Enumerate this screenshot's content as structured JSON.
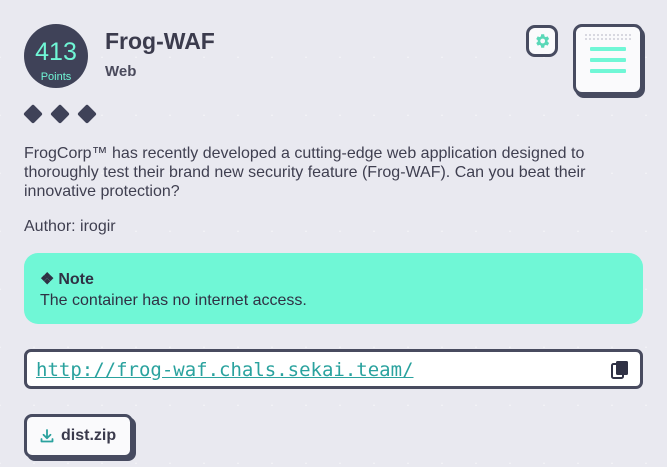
{
  "challenge": {
    "points": "413",
    "points_label": "Points",
    "title": "Frog-WAF",
    "category": "Web",
    "difficulty": 3,
    "description": "FrogCorp™ has recently developed a cutting-edge web application designed to thoroughly test their brand new security feature (Frog-WAF). Can you beat their innovative protection?",
    "author": "Author: irogir"
  },
  "note": {
    "symbol": "❖",
    "title": "Note",
    "text": "The container has no internet access."
  },
  "connection": {
    "url": "http://frog-waf.chals.sekai.team/"
  },
  "attachment": {
    "label": "dist.zip"
  },
  "icons": {
    "settings": "gear-icon",
    "menu": "hamburger-menu-icon",
    "copy": "copy-icon",
    "download": "download-icon"
  },
  "colors": {
    "accent": "#70f7d6",
    "dark": "#3f4258",
    "link": "#2aa29e"
  }
}
